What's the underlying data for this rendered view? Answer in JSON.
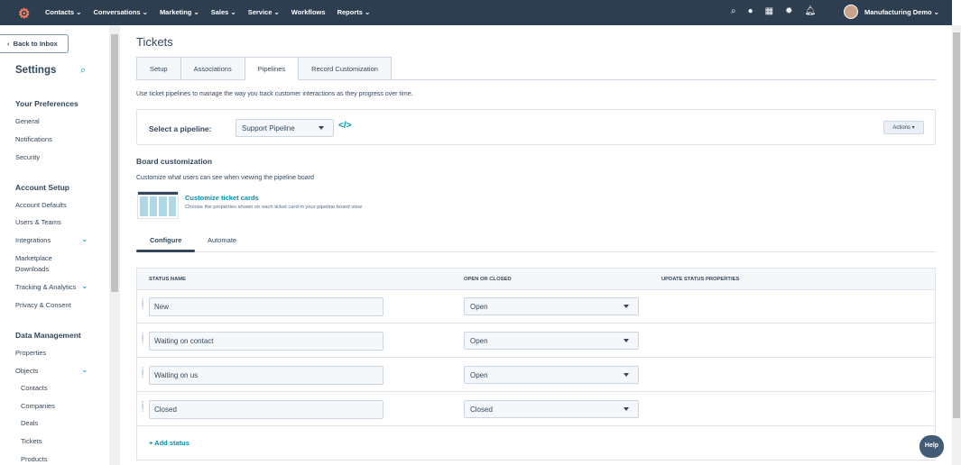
{
  "topnav": {
    "items": [
      "Contacts ⌄",
      "Conversations ⌄",
      "Marketing ⌄",
      "Sales ⌄",
      "Service ⌄",
      "Workflows",
      "Reports ⌄"
    ],
    "account": "Manufacturing Demo ⌄"
  },
  "sidebar": {
    "back": "Back to Inbox",
    "title": "Settings",
    "sections": [
      {
        "heading": "Your Preferences",
        "items": [
          "General",
          "Notifications",
          "Security"
        ]
      },
      {
        "heading": "Account Setup",
        "items": [
          "Account Defaults",
          "Users & Teams",
          "Integrations",
          "Marketplace Downloads",
          "Tracking & Analytics",
          "Privacy & Consent"
        ]
      },
      {
        "heading": "Data Management",
        "items": [
          "Properties",
          "Objects",
          "Contacts",
          "Companies",
          "Deals",
          "Tickets",
          "Products"
        ]
      }
    ]
  },
  "page": {
    "title": "Tickets",
    "tabs": [
      "Setup",
      "Associations",
      "Pipelines",
      "Record Customization"
    ],
    "description": "Use ticket pipelines to manage the way you track customer interactions as they progress over time.",
    "pipeline_label": "Select a pipeline:",
    "pipeline_value": "Support Pipeline",
    "actions": "Actions ▾",
    "board_heading": "Board customization",
    "board_desc": "Customize what users can see when viewing the pipeline board",
    "cards_link": "Customize ticket cards",
    "cards_desc": "Choose the properties shown on each ticket card in your pipeline board view",
    "subtabs": [
      "Configure",
      "Automate"
    ],
    "columns": [
      "STATUS NAME",
      "OPEN OR CLOSED",
      "UPDATE STATUS PROPERTIES"
    ],
    "rows": [
      {
        "name": "New",
        "state": "Open"
      },
      {
        "name": "Waiting on contact",
        "state": "Open"
      },
      {
        "name": "Waiting on us",
        "state": "Open"
      },
      {
        "name": "Closed",
        "state": "Closed"
      }
    ],
    "add_status": "+  Add status",
    "help": "Help"
  }
}
